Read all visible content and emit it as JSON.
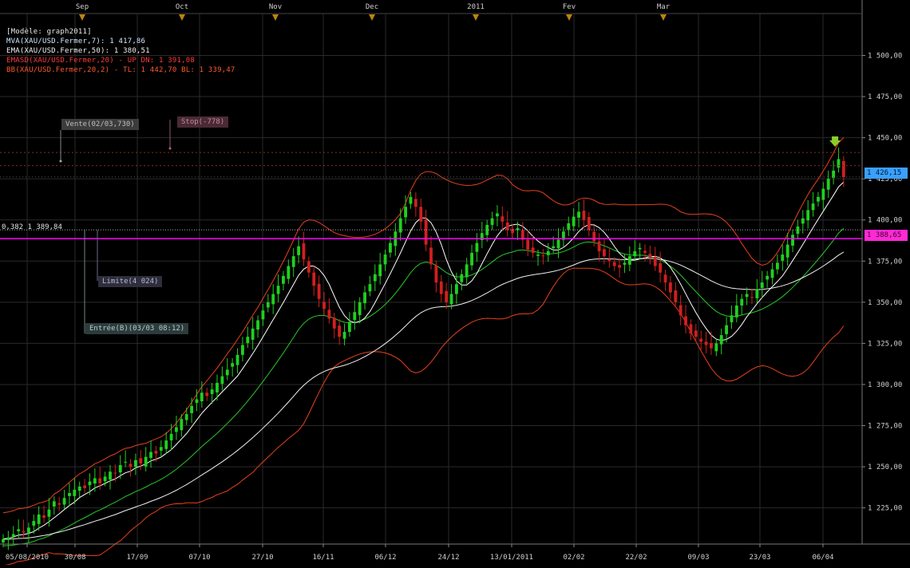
{
  "legend": {
    "model": "[Modèle: graph2011]",
    "mva": "MVA(XAU/USD.Fermer,7): 1 417,86",
    "ema": "EMA(XAU/USD.Fermer,50): 1 380,51",
    "emasd": "EMASD(XAU/USD.Fermer,20) - UP  DN: 1 391,08",
    "bb": "BB(XAU/USD.Fermer,20,2) - TL: 1 442,70 BL: 1 339,47"
  },
  "annotations": {
    "vente": "Vente(02/03,730)",
    "stop": "Stop(-778)",
    "limite": "Limite(4 024)",
    "entree": "Entrée(B)(03/03 08:12)",
    "fib": "0,382 1 389,84"
  },
  "badges": {
    "last": "1 426,15",
    "line": "1 388,65"
  },
  "colors": {
    "background": "#000000",
    "grid": "#2a2a2a",
    "up_candle": "#1fd11f",
    "down_candle": "#d11f1f",
    "mva_line": "#ffffff",
    "ema_line": "#f0f0f0",
    "ema_sd_line": "#28c828",
    "bb_line": "#e8401c",
    "magenta_line": "#ff00ff",
    "last_badge": "#3aa0ff",
    "line_badge": "#ff2ad4"
  },
  "chart_data": {
    "type": "candlestick",
    "symbol": "XAU/USD",
    "y_ticks": [
      "1 225,00",
      "1 250,00",
      "1 275,00",
      "1 300,00",
      "1 325,00",
      "1 350,00",
      "1 375,00",
      "1 400,00",
      "1 425,00",
      "1 450,00",
      "1 475,00",
      "1 500,00"
    ],
    "y_tick_values": [
      1225,
      1250,
      1275,
      1300,
      1325,
      1350,
      1375,
      1400,
      1425,
      1450,
      1475,
      1500
    ],
    "ylim": [
      1203,
      1524
    ],
    "x_labels": [
      "05/08/2010",
      "30/08",
      "17/09",
      "07/10",
      "27/10",
      "16/11",
      "06/12",
      "24/12",
      "13/01/2011",
      "02/02",
      "22/02",
      "09/03",
      "23/03",
      "06/04"
    ],
    "month_labels": [
      "Sep",
      "Oct",
      "Nov",
      "Dec",
      "2011",
      "Fev",
      "Mar"
    ],
    "bars_total": 168,
    "grid": true,
    "closes": [
      1206,
      1207,
      1209,
      1212,
      1210,
      1213,
      1217,
      1221,
      1219,
      1224,
      1229,
      1227,
      1231,
      1234,
      1236,
      1238,
      1237,
      1241,
      1243,
      1240,
      1244,
      1247,
      1246,
      1251,
      1253,
      1250,
      1254,
      1252,
      1256,
      1259,
      1258,
      1262,
      1266,
      1270,
      1274,
      1279,
      1282,
      1287,
      1291,
      1295,
      1293,
      1297,
      1301,
      1305,
      1309,
      1313,
      1318,
      1324,
      1329,
      1334,
      1339,
      1345,
      1350,
      1355,
      1360,
      1366,
      1372,
      1378,
      1384,
      1376,
      1368,
      1360,
      1352,
      1346,
      1340,
      1334,
      1329,
      1332,
      1338,
      1344,
      1350,
      1356,
      1361,
      1367,
      1373,
      1379,
      1386,
      1393,
      1401,
      1408,
      1414,
      1408,
      1399,
      1385,
      1373,
      1362,
      1355,
      1350,
      1355,
      1361,
      1367,
      1373,
      1380,
      1386,
      1392,
      1397,
      1401,
      1404,
      1399,
      1394,
      1392,
      1395,
      1388,
      1382,
      1380,
      1379,
      1378,
      1381,
      1384,
      1388,
      1393,
      1398,
      1402,
      1405,
      1400,
      1394,
      1387,
      1381,
      1378,
      1375,
      1372,
      1371,
      1374,
      1378,
      1381,
      1383,
      1380,
      1377,
      1372,
      1368,
      1362,
      1356,
      1350,
      1342,
      1336,
      1331,
      1329,
      1326,
      1324,
      1322,
      1325,
      1330,
      1336,
      1342,
      1348,
      1352,
      1355,
      1353,
      1358,
      1362,
      1366,
      1370,
      1374,
      1379,
      1385,
      1391,
      1396,
      1401,
      1406,
      1410,
      1414,
      1419,
      1425,
      1430,
      1437,
      1426
    ],
    "series": [
      {
        "name": "MVA(XAU/USD.Fermer,7)",
        "last": 1417.86
      },
      {
        "name": "EMA(XAU/USD.Fermer,50)",
        "last": 1380.51
      },
      {
        "name": "EMASD(XAU/USD.Fermer,20)",
        "last": 1391.08
      },
      {
        "name": "BB(XAU/USD.Fermer,20,2)",
        "upper": 1442.7,
        "lower": 1339.47
      }
    ],
    "levels": {
      "stop": 1441,
      "vente": 1433,
      "fib": 1394,
      "magenta": 1388.65,
      "last": 1426.15
    }
  }
}
